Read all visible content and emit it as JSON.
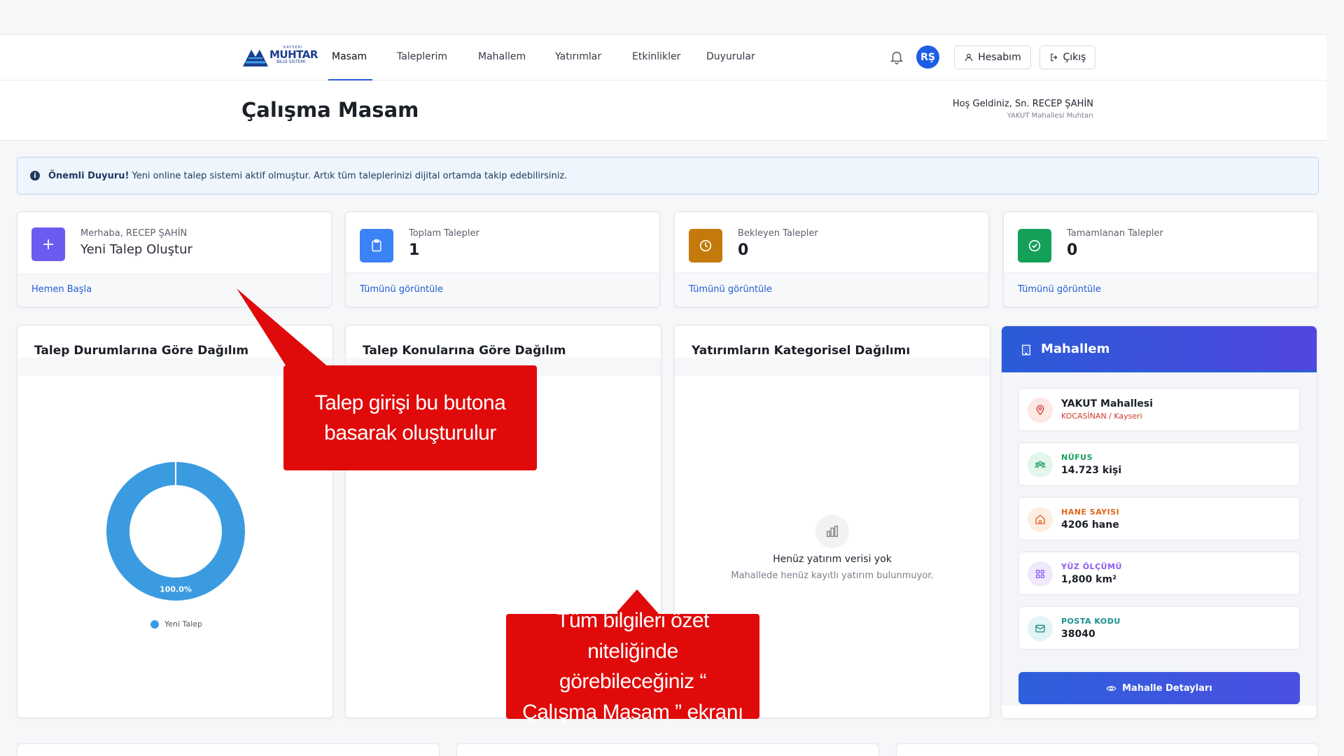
{
  "nav": {
    "logo": {
      "line1": "KAYSERİ",
      "line2": "MUHTAR",
      "line3": "BİLGİ SİSTEMİ"
    },
    "items": [
      {
        "label": "Masam",
        "active": true
      },
      {
        "label": "Taleplerim"
      },
      {
        "label": "Mahallem"
      },
      {
        "label": "Yatırımlar"
      },
      {
        "label": "Etkinlikler"
      },
      {
        "label": "Duyurular"
      }
    ],
    "avatar_initials": "RŞ",
    "account_label": "Hesabım",
    "logout_label": "Çıkış"
  },
  "header": {
    "title": "Çalışma Masam",
    "welcome": "Hoş Geldiniz, Sn. RECEP ŞAHİN",
    "role": "YAKUT Mahallesi Muhtarı"
  },
  "announcement": {
    "title": "Önemli Duyuru!",
    "text": "Yeni online talep sistemi aktif olmuştur. Artık tüm taleplerinizi dijital ortamda takip edebilirsiniz."
  },
  "stats": {
    "new_request": {
      "greeting": "Merhaba, RECEP ŞAHİN",
      "label": "Yeni Talep Oluştur",
      "link": "Hemen Başla",
      "color": "#6a5cf0"
    },
    "total": {
      "label": "Toplam Talepler",
      "value": "1",
      "link": "Tümünü görüntüle",
      "color": "#3b82f6"
    },
    "pending": {
      "label": "Bekleyen Talepler",
      "value": "0",
      "link": "Tümünü görüntüle",
      "color": "#c47a0a"
    },
    "done": {
      "label": "Tamamlanan Talepler",
      "value": "0",
      "link": "Tümünü görüntüle",
      "color": "#15a05a"
    }
  },
  "panels": {
    "status_title": "Talep Durumlarına Göre Dağılım",
    "topics_title": "Talep Konularına Göre Dağılım",
    "invest_title": "Yatırımların Kategorisel Dağılımı",
    "invest_empty_title": "Henüz yatırım verisi yok",
    "invest_empty_sub": "Mahallede henüz kayıtlı yatırım bulunmuyor."
  },
  "chart_data": {
    "type": "pie",
    "categories": [
      "Yeni Talep"
    ],
    "values": [
      100.0
    ],
    "data_labels": [
      "100.0%"
    ],
    "colors": [
      "#3b9be0"
    ],
    "legend": "bottom"
  },
  "mahallem": {
    "title": "Mahallem",
    "name": "YAKUT Mahallesi",
    "location": "KOCASİNAN / Kayseri",
    "population_label": "NÜFUS",
    "population": "14.723 kişi",
    "households_label": "HANE SAYISI",
    "households": "4206 hane",
    "area_label": "YÜZ ÖLÇÜMÜ",
    "area": "1,800 km²",
    "postal_label": "POSTA KODU",
    "postal": "38040",
    "details_button": "Mahalle Detayları"
  },
  "callouts": {
    "create": "Talep girişi bu butona basarak oluşturulur",
    "summary": "Tüm bilgileri özet niteliğinde görebileceğiniz “ Çalışma Masam ” ekranı"
  }
}
